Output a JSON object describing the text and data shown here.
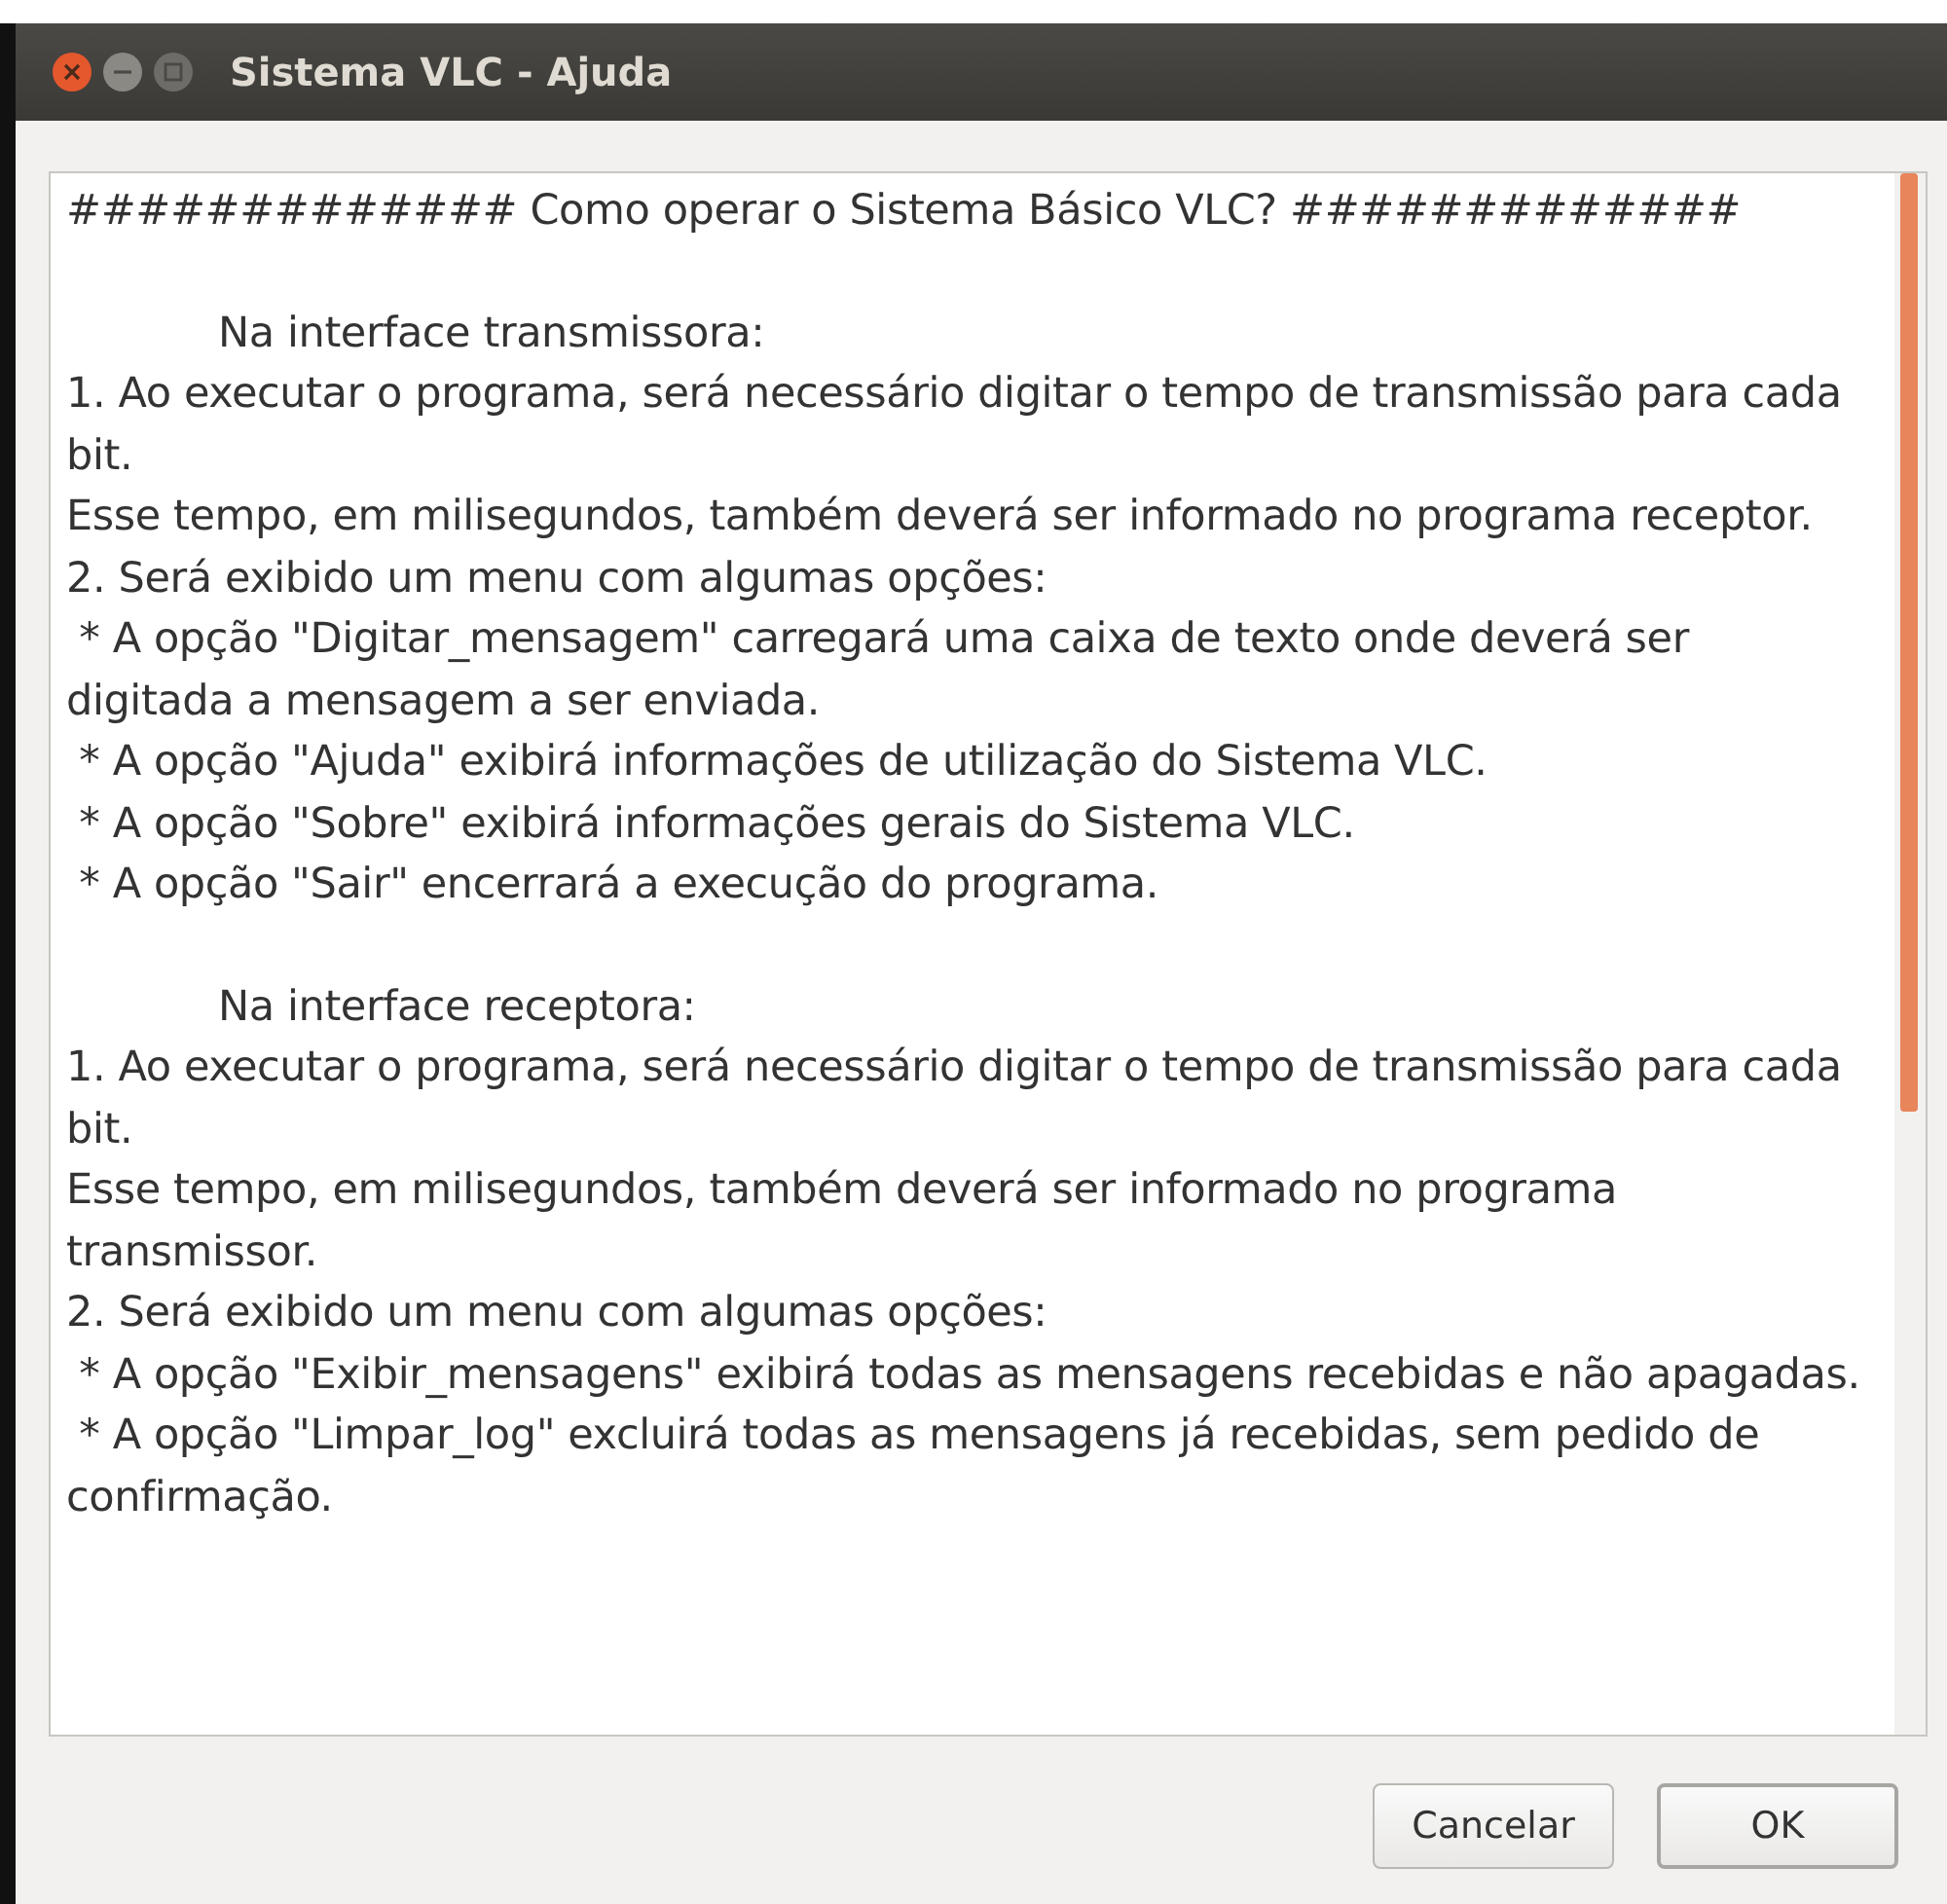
{
  "window": {
    "title": "Sistema VLC - Ajuda"
  },
  "help_text": [
    {
      "kind": "line",
      "text": "############# Como operar o Sistema Básico VLC? #############"
    },
    {
      "kind": "section",
      "text": "Na interface transmissora:"
    },
    {
      "kind": "line",
      "text": "1. Ao executar o programa, será necessário digitar o tempo de transmissão para cada bit."
    },
    {
      "kind": "line",
      "text": "Esse tempo, em milisegundos, também deverá ser informado no programa receptor."
    },
    {
      "kind": "line",
      "text": "2. Será exibido um menu com algumas opções:"
    },
    {
      "kind": "line",
      "text": " * A opção \"Digitar_mensagem\" carregará uma caixa de texto onde deverá ser digitada a mensagem a ser enviada."
    },
    {
      "kind": "line",
      "text": " * A opção \"Ajuda\" exibirá informações de utilização do Sistema VLC."
    },
    {
      "kind": "line",
      "text": " * A opção \"Sobre\" exibirá informações gerais do Sistema VLC."
    },
    {
      "kind": "line",
      "text": " * A opção \"Sair\" encerrará a execução do programa."
    },
    {
      "kind": "section",
      "text": "Na interface receptora:"
    },
    {
      "kind": "line",
      "text": "1. Ao executar o programa, será necessário digitar o tempo de transmissão para cada bit."
    },
    {
      "kind": "line",
      "text": "Esse tempo, em milisegundos, também deverá ser informado no programa transmissor."
    },
    {
      "kind": "line",
      "text": "2. Será exibido um menu com algumas opções:"
    },
    {
      "kind": "line",
      "text": " * A opção \"Exibir_mensagens\" exibirá todas as mensagens recebidas e não apagadas."
    },
    {
      "kind": "line",
      "text": " * A opção \"Limpar_log\" excluirá todas as mensagens já recebidas, sem pedido de confirmação."
    }
  ],
  "buttons": [
    {
      "label": "Cancelar",
      "selected": false
    },
    {
      "label": "OK",
      "selected": true
    }
  ]
}
